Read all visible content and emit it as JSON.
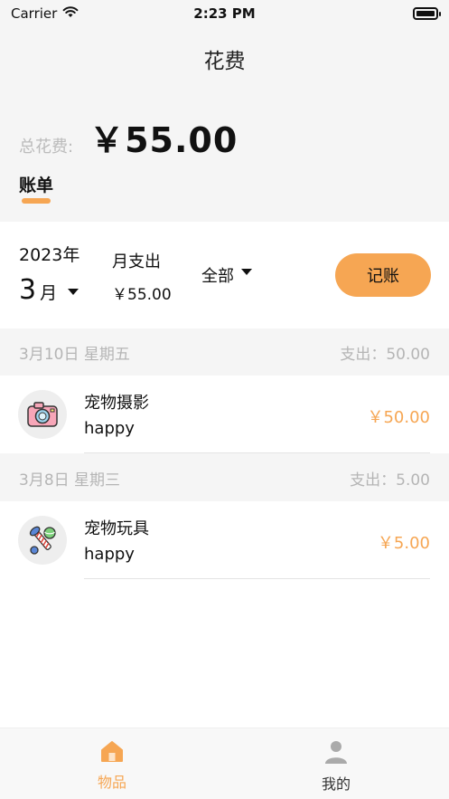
{
  "status_bar": {
    "carrier": "Carrier",
    "time": "2:23 PM"
  },
  "nav": {
    "title": "花费"
  },
  "total": {
    "label": "总花费:",
    "value": "￥55.00"
  },
  "tabs": {
    "bill": "账单"
  },
  "summary": {
    "year": "2023年",
    "month_num": "3",
    "month_unit": "月",
    "out_label": "月支出",
    "out_value": "￥55.00",
    "filter": "全部",
    "record_button": "记账"
  },
  "days": [
    {
      "date": "3月10日 星期五",
      "total": "支出：50.00",
      "items": [
        {
          "icon": "camera-icon",
          "name": "宠物摄影",
          "note": "happy",
          "amount": "￥50.00"
        }
      ]
    },
    {
      "date": "3月8日 星期三",
      "total": "支出：5.00",
      "items": [
        {
          "icon": "pet-toy-icon",
          "name": "宠物玩具",
          "note": "happy",
          "amount": "￥5.00"
        }
      ]
    }
  ],
  "tabbar": {
    "home_label": "物品",
    "me_label": "我的"
  },
  "colors": {
    "accent": "#f6a653",
    "muted": "#b5b5b5"
  }
}
